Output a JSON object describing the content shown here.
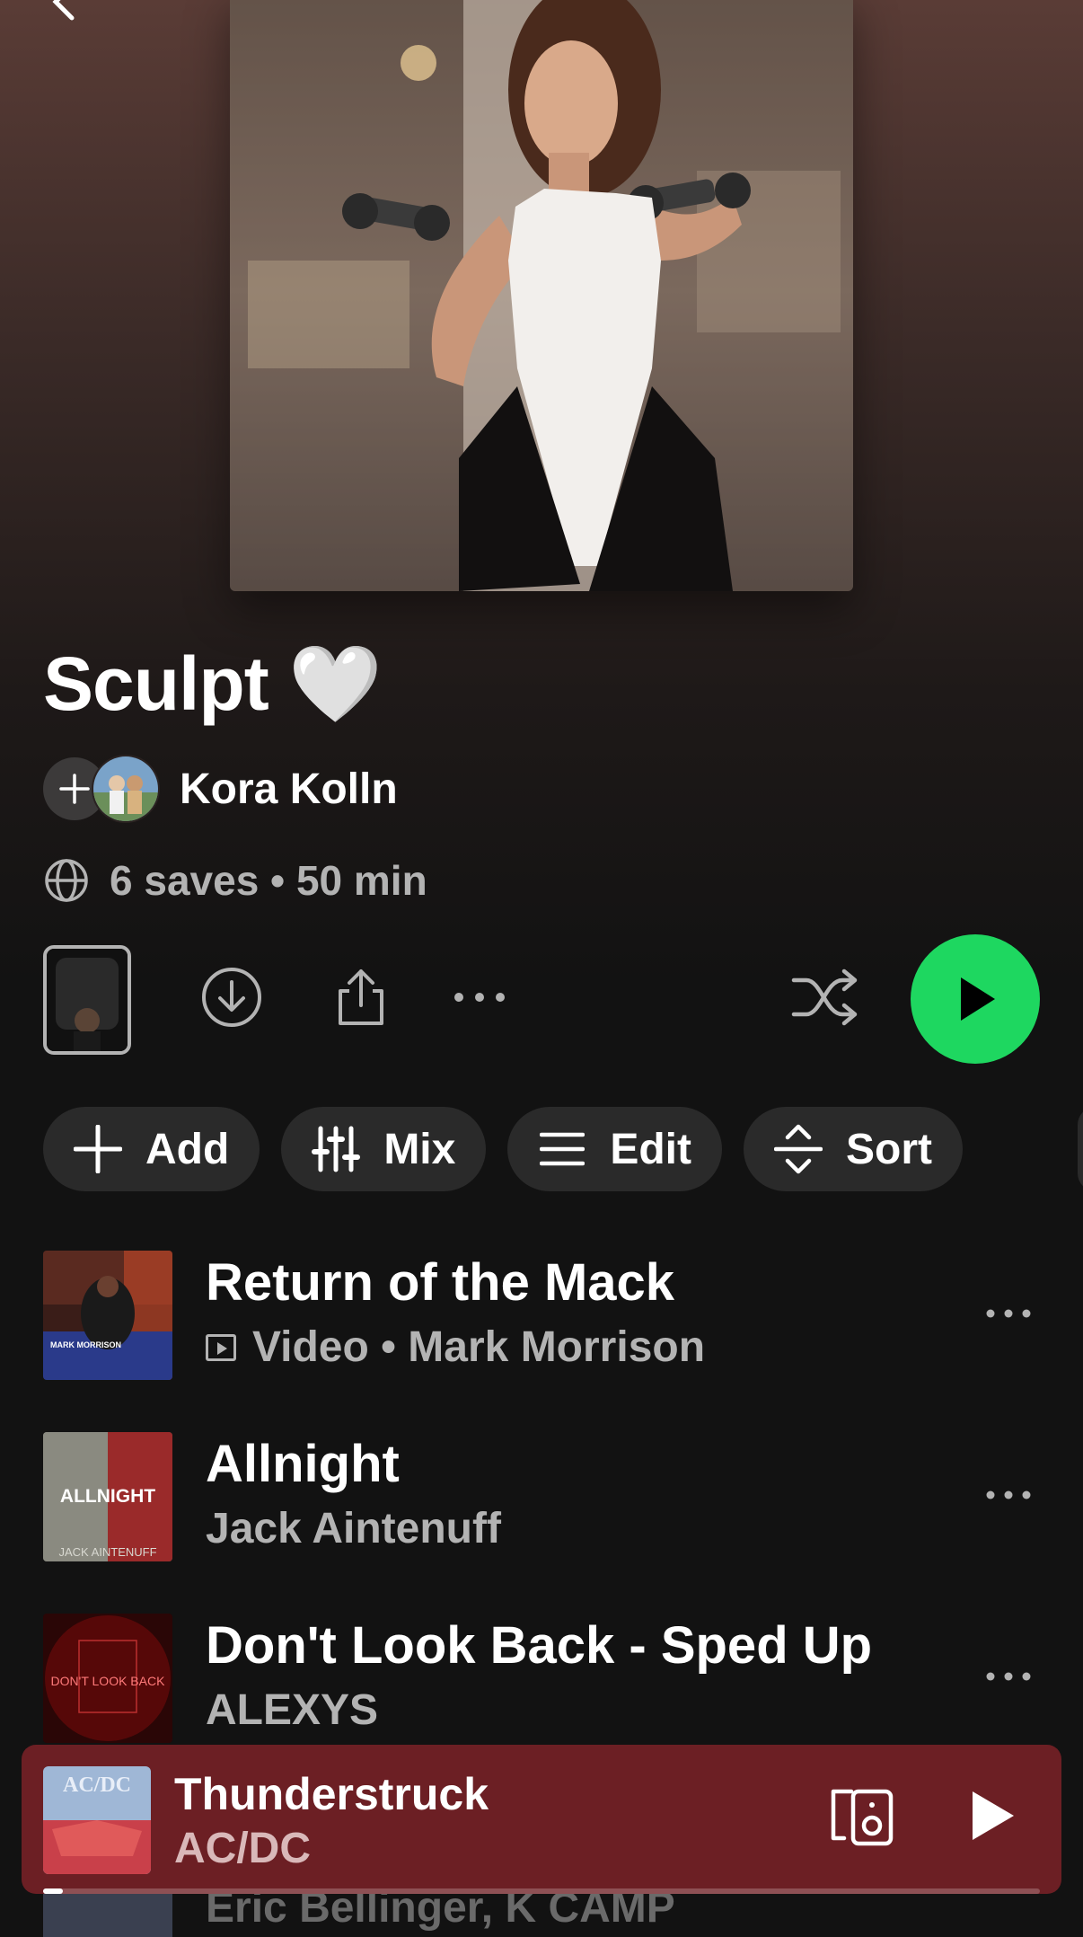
{
  "playlist": {
    "title": "Sculpt 🤍",
    "owner": "Kora Kolln",
    "meta": "6 saves • 50 min"
  },
  "chips": [
    {
      "label": "Add",
      "icon": "plus-icon"
    },
    {
      "label": "Mix",
      "icon": "sliders-icon"
    },
    {
      "label": "Edit",
      "icon": "list-icon"
    },
    {
      "label": "Sort",
      "icon": "sort-icon"
    }
  ],
  "tracks": [
    {
      "title": "Return of the Mack",
      "subtitle": "Video • Mark Morrison",
      "video": true
    },
    {
      "title": "Allnight",
      "subtitle": "Jack Aintenuff",
      "art_text": "ALLNIGHT",
      "art_subtext": "JACK AINTENUFF"
    },
    {
      "title": "Don't Look Back - Sped Up",
      "subtitle": "ALEXYS",
      "art_text": "DON'T LOOK BACK"
    }
  ],
  "ghost_row": {
    "text": "Eric Bellinger, K CAMP"
  },
  "now_playing": {
    "title": "Thunderstruck",
    "artist": "AC/DC",
    "art_text": "AC/DC",
    "progress": 0.02
  },
  "colors": {
    "accent_green": "#1ed760",
    "mini_player_bg": "#6c1f24",
    "background": "#121212"
  }
}
